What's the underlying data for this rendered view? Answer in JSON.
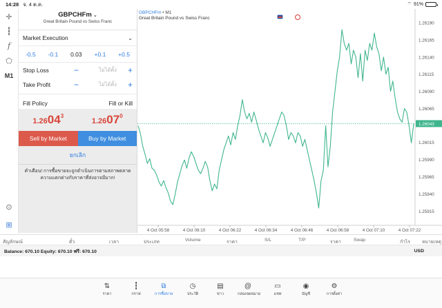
{
  "status": {
    "time": "14:28",
    "date": "จ. 4 ต.ค.",
    "battery": "91%"
  },
  "order": {
    "symbol": "GBPCHFm",
    "description": "Great Britain Pound vs Swiss Franc",
    "execution": "Market Execution",
    "volume": {
      "dec_big": "-0.5",
      "dec_small": "-0.1",
      "value": "0.03",
      "inc_small": "+0.1",
      "inc_big": "+0.5"
    },
    "stop_loss": {
      "label": "Stop Loss",
      "placeholder": "ไม่ได้ตั้ง"
    },
    "take_profit": {
      "label": "Take Profit",
      "placeholder": "ไม่ได้ตั้ง"
    },
    "fill_policy": {
      "label": "Fill Policy",
      "value": "Fill or Kill"
    },
    "bid": {
      "prefix": "1.26",
      "big": "04",
      "sup": "3"
    },
    "ask": {
      "prefix": "1.26",
      "big": "07",
      "sup": "0"
    },
    "sell_label": "Sell by Market",
    "buy_label": "Buy by Market",
    "cancel_label": "ยกเลิก",
    "warning": "คำเตือน! การซื้อขายจะถูกดำเนินการตามสภาพตลาด ความแตกต่างกับราคาที่ส่งอาจมีมาก!"
  },
  "chart_title": {
    "symbol": "GBPCHFm",
    "timeframe": "M1",
    "description": "Great Britain Pound vs Swiss Franc"
  },
  "left_tools": {
    "timeframe": "M1"
  },
  "chart_data": {
    "type": "line",
    "yticks": [
      "1.26190",
      "1.26165",
      "1.26140",
      "1.26115",
      "1.26090",
      "1.26065",
      "1.26043",
      "1.26015",
      "1.25990",
      "1.25965",
      "1.25940",
      "1.25915"
    ],
    "current_price": "1.26043",
    "xticks": [
      "4 Oct 05:58",
      "4 Oct 06:10",
      "4 Oct 06:22",
      "4 Oct 06:34",
      "4 Oct 06:46",
      "4 Oct 06:58",
      "4 Oct 07:10",
      "4 Oct 07:22"
    ],
    "ylim": [
      1.259,
      1.262
    ],
    "color": "#3fb58e",
    "values": [
      1.2604,
      1.26028,
      1.2601,
      1.25998,
      1.25985,
      1.25992,
      1.25978,
      1.25975,
      1.25968,
      1.25958,
      1.25952,
      1.2596,
      1.2595,
      1.25942,
      1.2593,
      1.25925,
      1.2594,
      1.25958,
      1.2597,
      1.25982,
      1.2599,
      1.25978,
      1.25993,
      1.26002,
      1.25995,
      1.25985,
      1.25975,
      1.2597,
      1.25978,
      1.25988,
      1.2598,
      1.2596,
      1.25945,
      1.25955,
      1.25948,
      1.25975,
      1.2599,
      1.26005,
      1.26015,
      1.26025,
      1.26012,
      1.2603,
      1.2602,
      1.2604,
      1.26055,
      1.26078,
      1.2606,
      1.2605,
      1.26058,
      1.26045,
      1.2606,
      1.26048,
      1.26035,
      1.26025,
      1.26015,
      1.2603,
      1.26022,
      1.2601,
      1.2602,
      1.2603,
      1.2604,
      1.2605,
      1.2606,
      1.26055,
      1.2604,
      1.2602,
      1.2603,
      1.26025,
      1.26015,
      1.2603,
      1.26025,
      1.2601,
      1.2602,
      1.26005,
      1.2599,
      1.25975,
      1.2596,
      1.25942,
      1.2592,
      1.2596,
      1.25975,
      1.2604,
      1.2598,
      1.2601,
      1.2606,
      1.2609,
      1.2612,
      1.2614,
      1.2618,
      1.2616,
      1.2615,
      1.2616,
      1.2613,
      1.2615,
      1.2614,
      1.2611,
      1.26145,
      1.26105,
      1.2615,
      1.26135,
      1.2616,
      1.2615,
      1.26175,
      1.26155,
      1.26145,
      1.2612,
      1.2614,
      1.26115,
      1.26125,
      1.2609,
      1.26105,
      1.2608,
      1.2606,
      1.2605,
      1.26045,
      1.26065,
      1.2606,
      1.2604,
      1.26015,
      1.26043
    ]
  },
  "columns": [
    "สัญลักษณ์",
    "ตั๋ว",
    "เวลา",
    "ประเภท",
    "Volume",
    "ราคา",
    "S/L",
    "T/P",
    "ราคา",
    "Swap",
    "กำไร",
    "หมายเหตุ"
  ],
  "balance": {
    "text": "Balance: 670.10 Equity: 670.10 ฟรี: 670.10",
    "currency": "USD"
  },
  "tabs": [
    {
      "label": "ราคา",
      "icon": "quotes-icon"
    },
    {
      "label": "กราฟ",
      "icon": "candles-icon"
    },
    {
      "label": "การซื้อขาย",
      "icon": "trade-icon",
      "active": true
    },
    {
      "label": "ประวัติ",
      "icon": "history-icon"
    },
    {
      "label": "ข่าว",
      "icon": "news-icon"
    },
    {
      "label": "กล่องจดหมาย",
      "icon": "mailbox-icon"
    },
    {
      "label": "แชท",
      "icon": "chat-icon"
    },
    {
      "label": "บัญชี",
      "icon": "account-icon"
    },
    {
      "label": "การตั้งค่า",
      "icon": "settings-icon"
    }
  ]
}
